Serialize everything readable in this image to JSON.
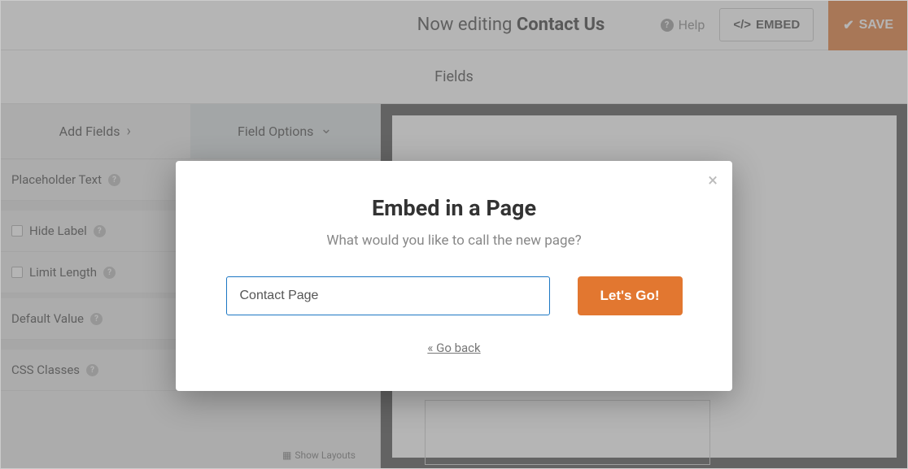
{
  "header": {
    "editing_prefix": "Now editing ",
    "form_name": "Contact Us",
    "help_label": "Help",
    "embed_label": "EMBED",
    "save_label": "SAVE"
  },
  "section": {
    "fields_title": "Fields"
  },
  "sidebar": {
    "tabs": {
      "add_fields": "Add Fields",
      "field_options": "Field Options"
    },
    "options": {
      "placeholder_text": "Placeholder Text",
      "hide_label": "Hide Label",
      "limit_length": "Limit Length",
      "default_value": "Default Value",
      "css_classes": "CSS Classes",
      "show_layouts": "Show Layouts"
    }
  },
  "modal": {
    "title": "Embed in a Page",
    "subtitle": "What would you like to call the new page?",
    "input_value": "Contact Page",
    "lets_go_label": "Let's Go!",
    "go_back_label": "« Go back"
  }
}
